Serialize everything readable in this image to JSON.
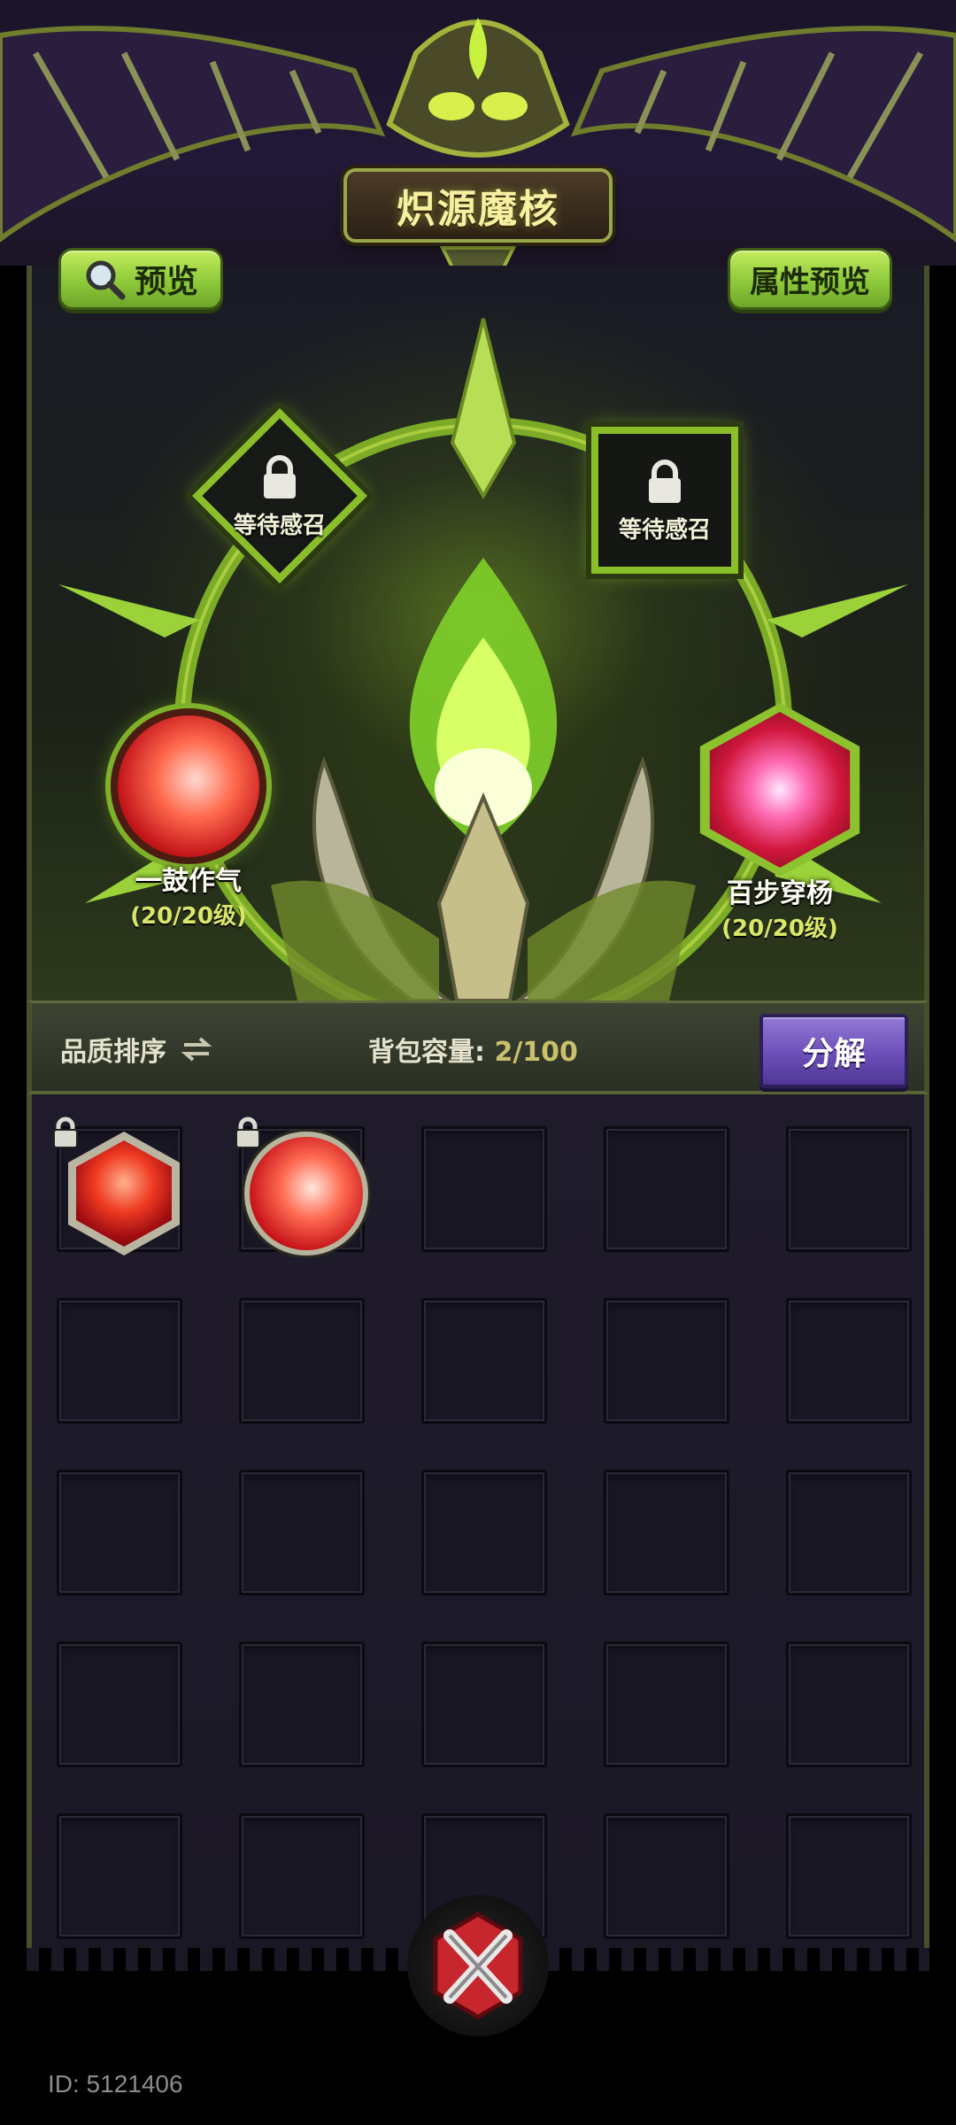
{
  "header": {
    "title": "炽源魔核",
    "preview_label": "预览",
    "attr_preview_label": "属性预览"
  },
  "altar": {
    "locked_slots": [
      {
        "label": "等待感召",
        "icon": "lock-icon"
      },
      {
        "label": "等待感召",
        "icon": "lock-icon"
      }
    ],
    "equipped": [
      {
        "name": "一鼓作气",
        "level": "(20/20级)",
        "icon": "red-sword-orb-icon"
      },
      {
        "name": "百步穿杨",
        "level": "(20/20级)",
        "icon": "piercing-arrow-hex-icon"
      }
    ]
  },
  "toolbar": {
    "sort_label": "品质排序",
    "sort_icon": "swap-arrows-icon",
    "capacity_label": "背包容量: ",
    "capacity_value": "2/100",
    "decompose_label": "分解"
  },
  "inventory": {
    "columns": 5,
    "rows": 5,
    "items": [
      {
        "slot": 1,
        "icon": "red-aura-hex-icon",
        "locked": true
      },
      {
        "slot": 2,
        "icon": "red-sword-orb-icon",
        "locked": true
      }
    ]
  },
  "footer": {
    "user_id": "ID: 5121406",
    "close_icon": "crossed-blades-close-icon"
  },
  "colors": {
    "accent_green": "#8dc93a",
    "panel_purple": "#1b1826",
    "decompose_purple": "#6c4fb8",
    "title_yellow": "#f6f1a0"
  }
}
